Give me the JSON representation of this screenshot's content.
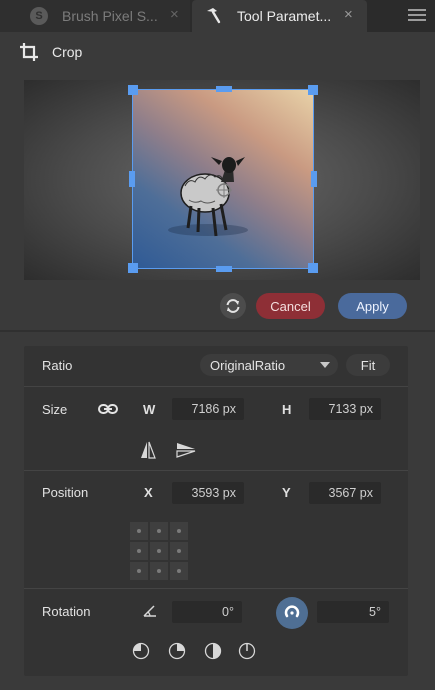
{
  "tabs": [
    {
      "label": "Brush Pixel S...",
      "close": "×",
      "active": false,
      "icon": "app-logo-icon"
    },
    {
      "label": "Tool Paramet...",
      "close": "×",
      "active": true,
      "icon": "hammer-icon"
    }
  ],
  "crop": {
    "title": "Crop",
    "icon": "crop-icon"
  },
  "actions": {
    "cancel": "Cancel",
    "apply": "Apply"
  },
  "params": {
    "ratio": {
      "label": "Ratio",
      "value": "OriginalRatio",
      "fit": "Fit"
    },
    "size": {
      "label": "Size",
      "w_label": "W",
      "w_value": "7186 px",
      "h_label": "H",
      "h_value": "7133 px"
    },
    "position": {
      "label": "Position",
      "x_label": "X",
      "x_value": "3593 px",
      "y_label": "Y",
      "y_value": "3567 px"
    },
    "rotation": {
      "label": "Rotation",
      "angle_value": "0°",
      "snap_value": "5°"
    }
  },
  "colors": {
    "accent": "#5a9cf0",
    "cancel": "#8e2f36",
    "apply": "#4a6a9c"
  }
}
